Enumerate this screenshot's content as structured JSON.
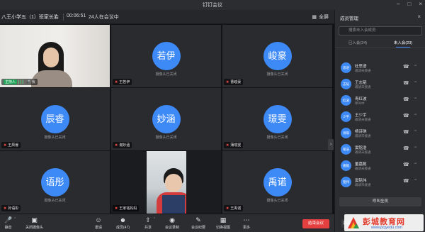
{
  "window": {
    "app_title": "钉钉会议"
  },
  "infobar": {
    "meeting_name": "八王小学五（1）班家长会",
    "timer": "00:06:51",
    "attendance": "24人在会议中",
    "fullscreen_label": "全屏"
  },
  "participants": [
    {
      "name": "我",
      "badge": "主持人",
      "video": true,
      "avatar_text": ""
    },
    {
      "name": "王若伊",
      "avatar_text": "若伊",
      "status": "摄像头已关闭"
    },
    {
      "name": "曹峻豪",
      "avatar_text": "峻豪",
      "status": "摄像头已关闭"
    },
    {
      "name": "王辰睿",
      "avatar_text": "辰睿",
      "status": "摄像头已关闭"
    },
    {
      "name": "谢妙涵",
      "avatar_text": "妙涵",
      "status": "摄像头已关闭"
    },
    {
      "name": "蒲璟雯",
      "avatar_text": "璟雯",
      "status": "摄像头已关闭"
    },
    {
      "name": "孙语彤",
      "avatar_text": "语彤",
      "status": "摄像头已关闭"
    },
    {
      "name": "王家铭妈妈",
      "video": true,
      "avatar_text": ""
    },
    {
      "name": "王禹诺",
      "avatar_text": "禹诺",
      "status": "摄像头已关闭"
    }
  ],
  "toolbar": {
    "mute": "静音",
    "camera": "关闭摄像头",
    "invite": "邀请",
    "members": "成员(47)",
    "share": "共享",
    "record": "会议录制",
    "minutes": "会议纪要",
    "layout": "切换视图",
    "more": "更多",
    "end": "结束会议"
  },
  "panel": {
    "title": "成员管理",
    "search_placeholder": "搜索未入会成员",
    "tab_joined": "已入会(24)",
    "tab_not_joined": "未入会(23)",
    "members": [
      {
        "avatar": "思语",
        "name": "杜思语",
        "status": "邀请未接通"
      },
      {
        "avatar": "志韬",
        "name": "王志韬",
        "status": "邀请未接通"
      },
      {
        "avatar": "红波",
        "name": "青红波",
        "status": "呼叫中"
      },
      {
        "avatar": "少宇",
        "name": "王少宇",
        "status": "邀请未接通"
      },
      {
        "avatar": "诗琪",
        "name": "杨诗琪",
        "status": "邀请未接通"
      },
      {
        "avatar": "铭浩",
        "name": "窦铭浩",
        "status": "邀请未接通"
      },
      {
        "avatar": "嘉懿",
        "name": "董嘉懿",
        "status": "邀请未接通"
      },
      {
        "avatar": "铭伟",
        "name": "窦铭伟",
        "status": "邀请未接通"
      }
    ],
    "call_all": "呼叫全员",
    "invite_short": "邀请"
  },
  "watermark": {
    "title": "彭城教育网",
    "url": "www.pcjyedu.com"
  },
  "colors": {
    "accent": "#3d8af7",
    "end_button": "#e63f3f",
    "host_badge": "#22a55b"
  }
}
